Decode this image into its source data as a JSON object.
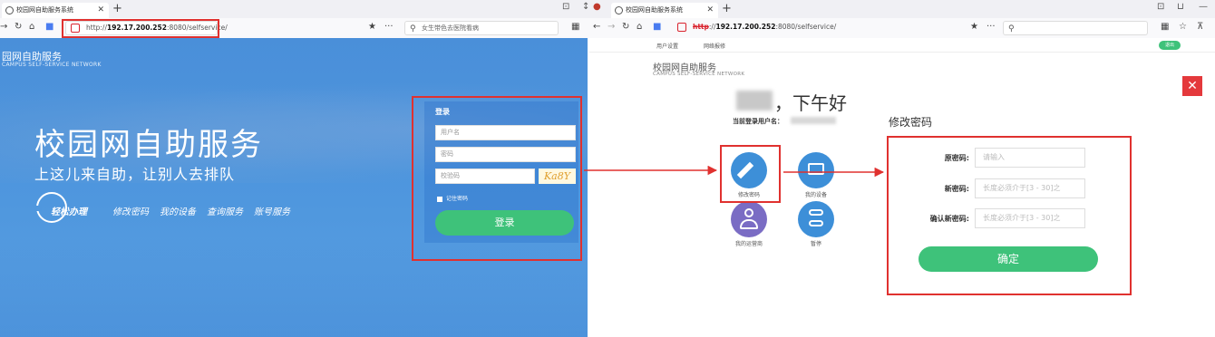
{
  "left_browser": {
    "tab_title": "校园网自助服务系统",
    "url_prefix": "http://",
    "url_host": "192.17.200.252",
    "url_rest": ":8080/selfservice/",
    "search_text": "女生带色去医院看病"
  },
  "right_browser": {
    "tab_title": "校园网自助服务系统",
    "url_scheme": "http",
    "url_rest_a": "://",
    "url_host": "192.17.200.252",
    "url_rest_b": ":8080/selfservice/",
    "search_text": " "
  },
  "login_page": {
    "brand_cn": "园网自助服务",
    "brand_en": "CAMPUS SELF-SERVICE NETWORK",
    "hero_title": "校园网自助服务",
    "hero_subtitle": "上这儿来自助，让别人去排队",
    "easy_label": "轻松办理",
    "quick_links": [
      "修改密码",
      "我的设备",
      "查询服务",
      "账号服务"
    ],
    "login_title": "登录",
    "username_placeholder": "用户名",
    "password_placeholder": "密码",
    "captcha_placeholder": "校验码",
    "captcha_text": "Ka8Y",
    "remember_label": "记住密码",
    "login_button": "登录"
  },
  "service_page": {
    "menu": [
      "用户设置",
      "网络报修"
    ],
    "exit_button": "退出",
    "brand_cn": "校园网自助服务",
    "brand_en": "CAMPUS  SELF-SERVICE NETWORK",
    "greeting": "，下午好",
    "current_user_label": "当前登录用户名：",
    "services": [
      {
        "label": "修改密码",
        "icon": "pencil-icon",
        "color": "#3d8fd8"
      },
      {
        "label": "我的设备",
        "icon": "device-icon",
        "color": "#3d8fd8"
      },
      {
        "label": "我的运营商",
        "icon": "person-icon",
        "color": "#7a6cc4"
      },
      {
        "label": "暂停",
        "icon": "toggle-icon",
        "color": "#3d8fd8"
      }
    ],
    "password_form": {
      "title": "修改密码",
      "old_label": "原密码:",
      "old_placeholder": "请输入",
      "new_label": "新密码:",
      "new_placeholder": "长度必须介于[3 - 30]之",
      "confirm_label": "确认新密码:",
      "confirm_placeholder": "长度必须介于[3 - 30]之",
      "submit_button": "确定"
    }
  },
  "colors": {
    "highlight_red": "#e0312f",
    "button_green": "#3ec27a",
    "login_blue": "#4f97de"
  }
}
